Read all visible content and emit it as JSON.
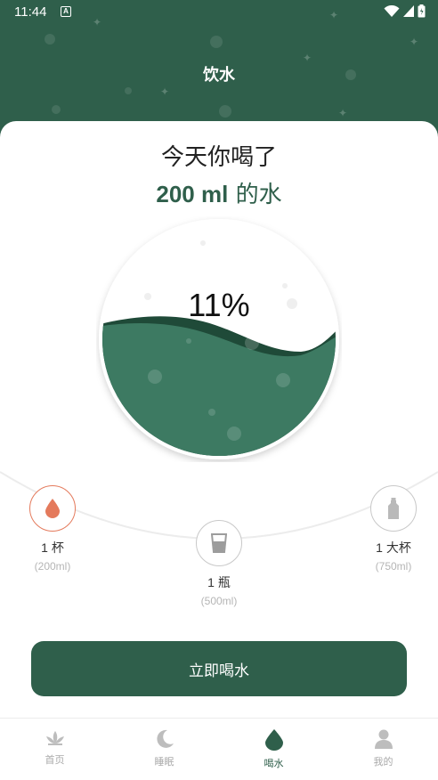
{
  "status_bar": {
    "time": "11:44",
    "notification_letter": "A",
    "icons": [
      "wifi-icon",
      "signal-icon",
      "battery-icon"
    ]
  },
  "header": {
    "title": "饮水"
  },
  "summary": {
    "line1": "今天你喝了",
    "amount": "200 ml",
    "suffix": " 的水"
  },
  "gauge": {
    "percent_text": "11%",
    "fill_fraction": 0.11
  },
  "options": [
    {
      "name": "1 杯",
      "volume": "(200ml)",
      "icon": "water-drop-icon",
      "selected": true
    },
    {
      "name": "1 瓶",
      "volume": "(500ml)",
      "icon": "glass-icon",
      "selected": false
    },
    {
      "name": "1 大杯",
      "volume": "(750ml)",
      "icon": "bottle-icon",
      "selected": false
    }
  ],
  "action": {
    "drink_now_label": "立即喝水"
  },
  "tabbar": {
    "tabs": [
      {
        "label": "首页",
        "icon": "lotus-icon",
        "active": false
      },
      {
        "label": "睡眠",
        "icon": "moon-icon",
        "active": false
      },
      {
        "label": "喝水",
        "icon": "water-drop-icon",
        "active": true
      },
      {
        "label": "我的",
        "icon": "person-icon",
        "active": false
      }
    ]
  },
  "colors": {
    "primary": "#2f5f4b",
    "accent": "#e47a5c",
    "wave_dark": "#1f4a38"
  }
}
